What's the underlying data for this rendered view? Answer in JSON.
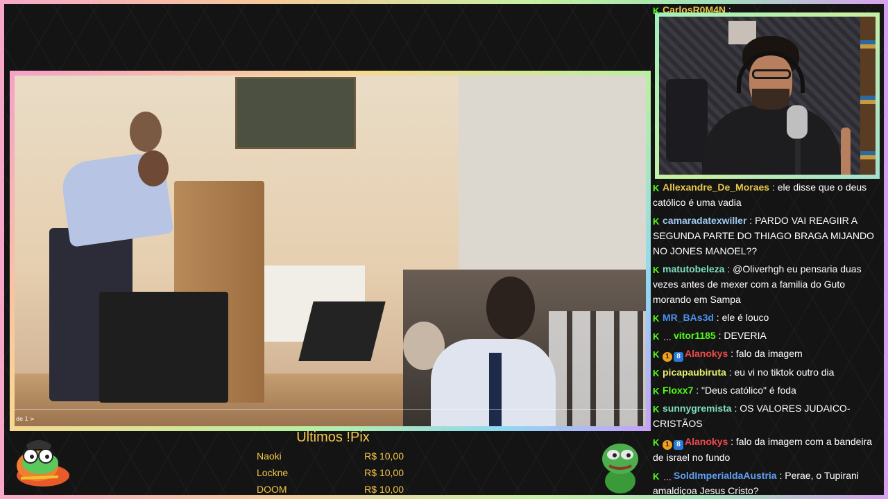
{
  "chat_top": {
    "user": "CarlosR0M4N",
    "sep": " :"
  },
  "video": {
    "page_indicator": "de 1 >"
  },
  "chat": [
    {
      "badges": [
        "k"
      ],
      "user": "Allexandre_De_Moraes",
      "color": "#e8c84a",
      "text": " : ele disse que o deus católico é uma vadia"
    },
    {
      "badges": [
        "k"
      ],
      "user": "camaradatexwiller",
      "color": "#9ec8f0",
      "text": " : PARDO VAI REAGIIR A SEGUNDA PARTE DO THIAGO BRAGA MIJANDO NO JONES MANOEL??"
    },
    {
      "badges": [
        "k"
      ],
      "user": "matutobeleza",
      "color": "#7ee0c0",
      "text": " : @Oliverhgh eu pensaria duas vezes antes de mexer com a familia do Guto morando em Sampa"
    },
    {
      "badges": [
        "k"
      ],
      "user": "MR_BAs3d",
      "color": "#4a90f0",
      "text": " : ele é louco"
    },
    {
      "badges": [
        "k",
        "dots"
      ],
      "user": "vitor1185",
      "color": "#53fc18",
      "text": " : DEVERIA"
    },
    {
      "badges": [
        "k",
        "coin",
        "gift"
      ],
      "user": "Alanokys",
      "color": "#f04a4a",
      "text": " : falo da imagem"
    },
    {
      "badges": [
        "k"
      ],
      "user": "picapaubiruta",
      "color": "#e8f070",
      "text": " : eu vi no tiktok outro dia"
    },
    {
      "badges": [
        "k"
      ],
      "user": "Floxx7",
      "color": "#53fc18",
      "text": " : \"Deus católico\" é foda"
    },
    {
      "badges": [
        "k"
      ],
      "user": "sunnygremista",
      "color": "#7ee0c0",
      "text": " : OS VALORES JUDAICO-CRISTÃOS"
    },
    {
      "badges": [
        "k",
        "coin",
        "gift"
      ],
      "user": "Alanokys",
      "color": "#f04a4a",
      "text": " : falo da imagem com a bandeira de israel no fundo"
    },
    {
      "badges": [
        "k",
        "dots"
      ],
      "user": "SoldImperialdaAustria",
      "color": "#60a0f0",
      "text": " : Perae, o Tupirani amaldiçoa Jesus Cristo?"
    }
  ],
  "pix": {
    "title": "Ultimos !Pix",
    "rows": [
      {
        "name": "Naoki",
        "amount": "R$ 10,00"
      },
      {
        "name": "Lockne",
        "amount": "R$ 10,00"
      },
      {
        "name": "DOOM",
        "amount": "R$ 10,00"
      }
    ]
  },
  "colors": {
    "kick_green": "#53fc18",
    "pix_gold": "#f5c84a"
  }
}
